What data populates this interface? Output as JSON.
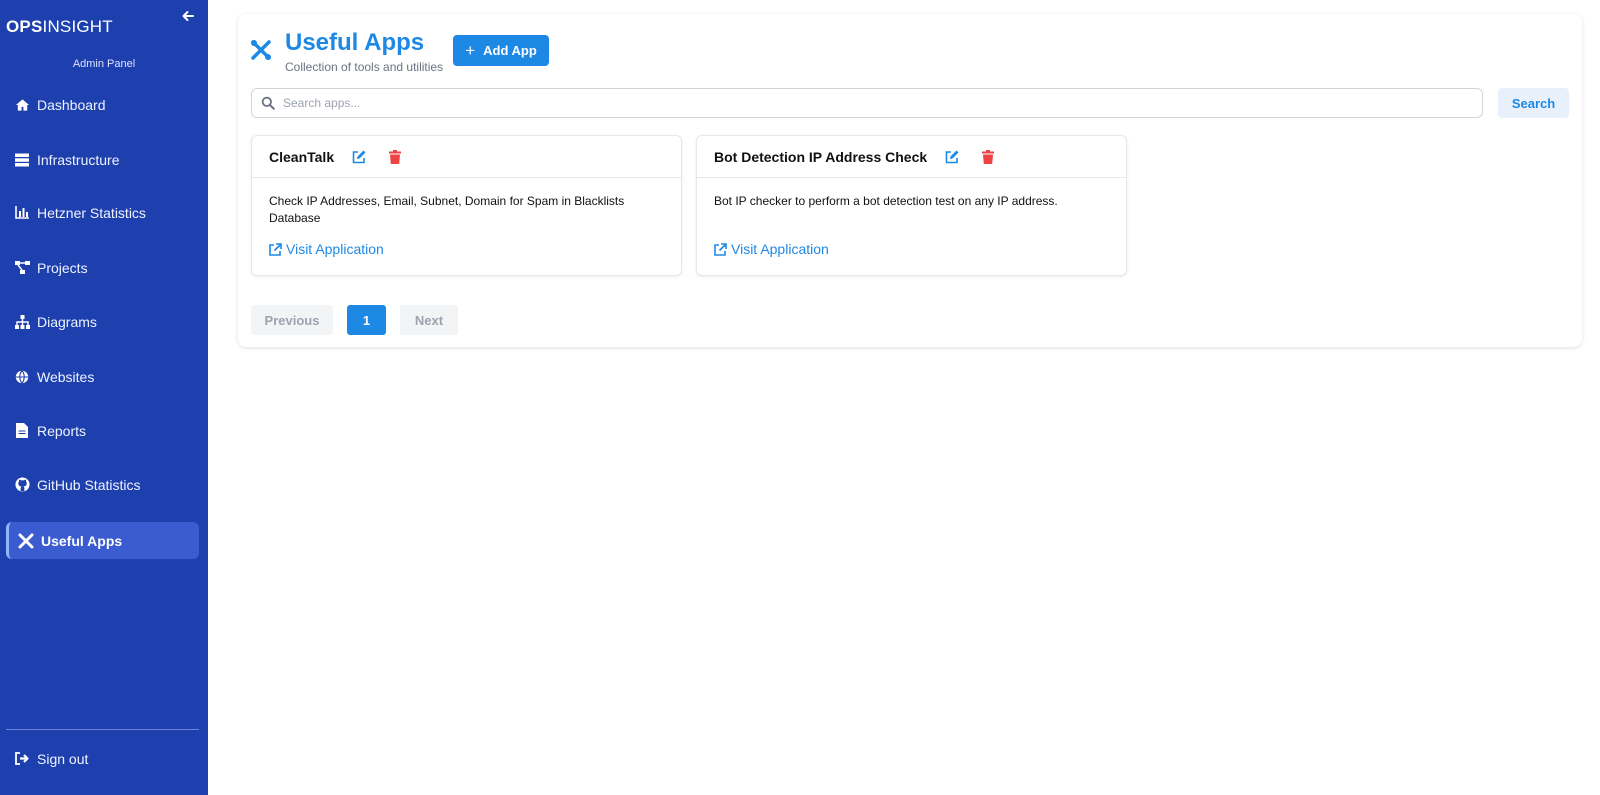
{
  "sidebar": {
    "brand_bold": "OPS",
    "brand_rest": "INSIGHT",
    "subtitle": "Admin Panel",
    "items": [
      {
        "label": "Dashboard",
        "icon": "home-icon"
      },
      {
        "label": "Infrastructure",
        "icon": "server-icon"
      },
      {
        "label": "Hetzner Statistics",
        "icon": "bar-chart-icon"
      },
      {
        "label": "Projects",
        "icon": "project-diagram-icon"
      },
      {
        "label": "Diagrams",
        "icon": "sitemap-icon"
      },
      {
        "label": "Websites",
        "icon": "globe-icon"
      },
      {
        "label": "Reports",
        "icon": "file-icon"
      },
      {
        "label": "GitHub Statistics",
        "icon": "github-icon"
      },
      {
        "label": "Useful Apps",
        "icon": "tools-icon",
        "active": true
      }
    ],
    "signout_label": "Sign out"
  },
  "header": {
    "title": "Useful Apps",
    "subtitle": "Collection of tools and utilities",
    "add_button_label": "Add App"
  },
  "search": {
    "placeholder": "Search apps...",
    "button_label": "Search"
  },
  "apps": [
    {
      "name": "CleanTalk",
      "description": "Check IP Addresses, Email, Subnet, Domain for Spam in Blacklists Database",
      "link_label": "Visit Application"
    },
    {
      "name": "Bot Detection IP Address Check",
      "description": "Bot IP checker to perform a bot detection test on any IP address.",
      "link_label": "Visit Application"
    }
  ],
  "pagination": {
    "previous_label": "Previous",
    "current_page": "1",
    "next_label": "Next"
  },
  "colors": {
    "sidebar_bg": "#1e40af",
    "accent": "#1e88e5",
    "danger": "#ef4444"
  }
}
